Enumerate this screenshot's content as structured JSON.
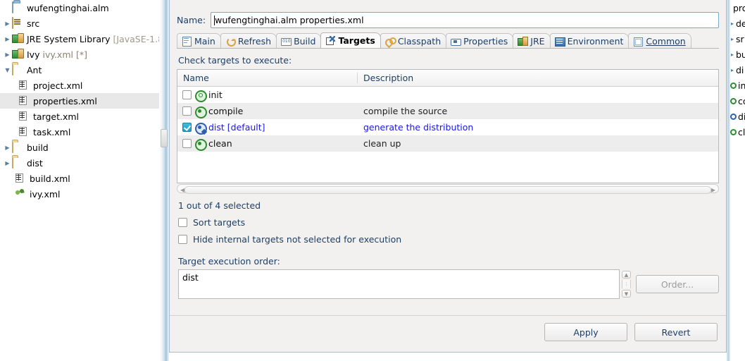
{
  "project_tree": {
    "items": [
      {
        "label": "wufengtinghai.alm",
        "icon": "project-icon",
        "indent": 0,
        "twisty": "none",
        "selected": false
      },
      {
        "label": "src",
        "icon": "source-folder-icon",
        "indent": 0,
        "twisty": "collapsed",
        "selected": false
      },
      {
        "label": "JRE System Library ",
        "suffix": "[JavaSE-1.8",
        "icon": "library-icon",
        "indent": 0,
        "twisty": "collapsed",
        "selected": false
      },
      {
        "label": "Ivy ",
        "suffix": "ivy.xml [*]",
        "icon": "library-icon",
        "indent": 0,
        "twisty": "collapsed",
        "selected": false
      },
      {
        "label": "Ant",
        "icon": "folder-icon",
        "indent": 0,
        "twisty": "expanded",
        "selected": false
      },
      {
        "label": "project.xml",
        "icon": "ant-file-icon",
        "indent": 1,
        "twisty": "none",
        "selected": false
      },
      {
        "label": "properties.xml",
        "icon": "ant-file-icon",
        "indent": 1,
        "twisty": "none",
        "selected": true
      },
      {
        "label": "target.xml",
        "icon": "ant-file-icon",
        "indent": 1,
        "twisty": "none",
        "selected": false
      },
      {
        "label": "task.xml",
        "icon": "ant-file-icon",
        "indent": 1,
        "twisty": "none",
        "selected": false
      },
      {
        "label": "build",
        "icon": "folder-icon",
        "indent": 0,
        "twisty": "collapsed",
        "selected": false
      },
      {
        "label": "dist",
        "icon": "folder-icon",
        "indent": 0,
        "twisty": "collapsed",
        "selected": false
      },
      {
        "label": "build.xml",
        "icon": "ant-file-icon",
        "indent": 0,
        "twisty": "none",
        "selected": false
      },
      {
        "label": "ivy.xml",
        "icon": "ivy-icon",
        "indent": 0,
        "twisty": "none",
        "selected": false
      }
    ]
  },
  "dialog": {
    "name_label": "Name:",
    "name_value": "wufengtinghai.alm properties.xml",
    "tabs": [
      {
        "label": "Main",
        "icon": "main-tab-icon",
        "active": false
      },
      {
        "label": "Refresh",
        "icon": "refresh-tab-icon",
        "active": false
      },
      {
        "label": "Build",
        "icon": "build-tab-icon",
        "active": false
      },
      {
        "label": "Targets",
        "icon": "targets-tab-icon",
        "active": true
      },
      {
        "label": "Classpath",
        "icon": "classpath-tab-icon",
        "active": false
      },
      {
        "label": "Properties",
        "icon": "properties-tab-icon",
        "active": false
      },
      {
        "label": "JRE",
        "icon": "jre-tab-icon",
        "active": false
      },
      {
        "label": "Environment",
        "icon": "environment-tab-icon",
        "active": false
      },
      {
        "label": "Common",
        "icon": "common-tab-icon",
        "active": false,
        "mnemonic": true
      }
    ],
    "targets_tab": {
      "hint": "Check targets to execute:",
      "columns": {
        "name": "Name",
        "description": "Description"
      },
      "rows": [
        {
          "name": "init",
          "description": "",
          "checked": false,
          "default": false,
          "internal": true
        },
        {
          "name": "compile",
          "description": "compile the source",
          "checked": false,
          "default": false,
          "internal": false
        },
        {
          "name": "dist [default]",
          "description": "generate the distribution",
          "checked": true,
          "default": true,
          "internal": false
        },
        {
          "name": "clean",
          "description": "clean up",
          "checked": false,
          "default": false,
          "internal": false
        }
      ],
      "selected_count": "1 out of 4 selected",
      "sort_targets_label": "Sort targets",
      "sort_targets_checked": false,
      "hide_internal_label": "Hide internal targets not selected for execution",
      "hide_internal_checked": false,
      "execution_order_label": "Target execution order:",
      "execution_order_value": "dist",
      "order_button_label": "Order...",
      "order_button_enabled": false
    },
    "footer": {
      "apply_label": "Apply",
      "revert_label": "Revert"
    }
  },
  "right_panel": {
    "items": [
      {
        "label": "pro",
        "type": "text"
      },
      {
        "label": "de",
        "type": "collapsed"
      },
      {
        "label": "sr",
        "type": "collapsed"
      },
      {
        "label": "bu",
        "type": "collapsed"
      },
      {
        "label": "di",
        "type": "collapsed"
      },
      {
        "label": "in",
        "type": "target"
      },
      {
        "label": "co",
        "type": "target"
      },
      {
        "label": "di",
        "type": "target-default"
      },
      {
        "label": "cl",
        "type": "target"
      }
    ]
  },
  "colors": {
    "link_blue": "#1818e0",
    "label_blue": "#1d3f66",
    "checkbox_accent": "#1f9fc8",
    "selection_gray": "#e8e8e8",
    "dialog_bg": "#f2f1f0"
  }
}
